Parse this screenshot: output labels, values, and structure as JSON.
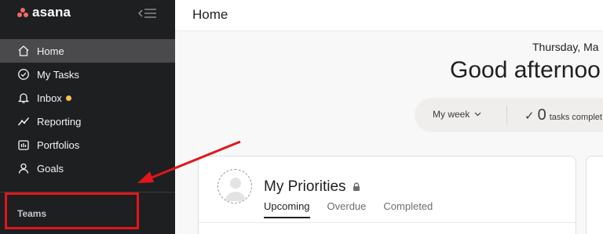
{
  "sidebar": {
    "logo_text": "asana",
    "nav_items": [
      {
        "label": "Home",
        "icon": "home-icon"
      },
      {
        "label": "My Tasks",
        "icon": "check-circle-icon"
      },
      {
        "label": "Inbox",
        "icon": "bell-icon"
      },
      {
        "label": "Reporting",
        "icon": "chart-line-icon"
      },
      {
        "label": "Portfolios",
        "icon": "portfolio-icon"
      },
      {
        "label": "Goals",
        "icon": "person-icon"
      }
    ],
    "teams_label": "Teams"
  },
  "header": {
    "title": "Home"
  },
  "home": {
    "date": "Thursday, Ma",
    "greeting": "Good afternoo",
    "stats": {
      "week_select": "My week",
      "count": "0",
      "label": "tasks complet"
    }
  },
  "priorities": {
    "title": "My Priorities",
    "tabs": [
      "Upcoming",
      "Overdue",
      "Completed"
    ]
  },
  "colors": {
    "sidebar_bg": "#1e1f21",
    "accent_logo": "#f06a6a",
    "inbox_dot": "#f8c14b",
    "annotation_red": "#e0161b"
  }
}
